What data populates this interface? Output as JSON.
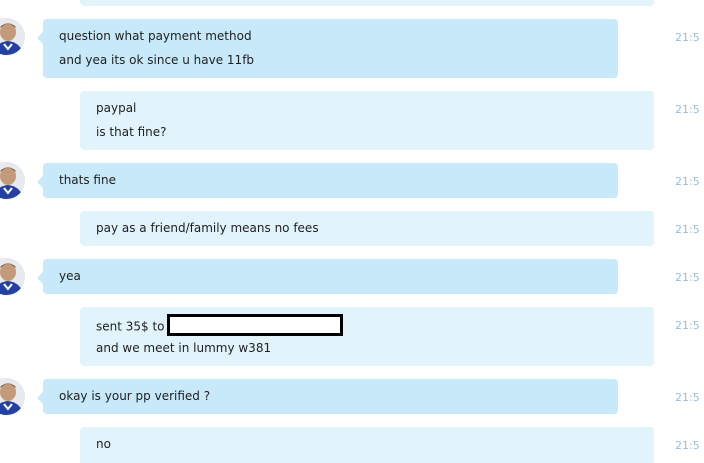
{
  "messages": [
    {
      "side": "them",
      "lines": [
        "question what payment method",
        "and yea its ok since u have 11fb"
      ],
      "time": "21:5"
    },
    {
      "side": "me",
      "lines": [
        "paypal",
        "is that fine?"
      ],
      "time": "21:5"
    },
    {
      "side": "them",
      "lines": [
        "thats fine"
      ],
      "time": "21:5"
    },
    {
      "side": "me",
      "lines": [
        "pay as a friend/family means no fees"
      ],
      "time": "21:5"
    },
    {
      "side": "them",
      "lines": [
        "yea"
      ],
      "time": "21:5"
    },
    {
      "side": "me",
      "lines": [
        "sent 35$ to",
        "and we meet in lummy w381"
      ],
      "time": "21:5",
      "redacted": true
    },
    {
      "side": "them",
      "lines": [
        "okay is your pp verified ?"
      ],
      "time": "21:5"
    },
    {
      "side": "me",
      "lines": [
        "no"
      ],
      "time": "21:5"
    }
  ],
  "colors": {
    "incoming_bubble": "#c7e9f9",
    "outgoing_bubble": "#e1f3fb",
    "timestamp": "#98bed4",
    "redaction_border": "#000000"
  },
  "icons": {
    "avatar": "contact-avatar-icon"
  }
}
